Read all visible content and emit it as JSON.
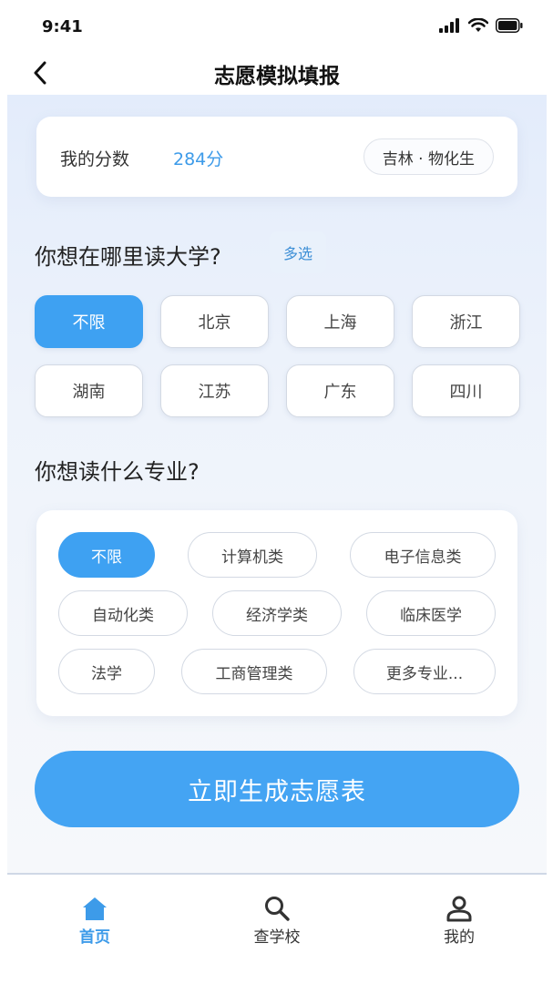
{
  "status_bar": {
    "time": "9:41"
  },
  "nav": {
    "title": "志愿模拟填报"
  },
  "score_card": {
    "label": "我的分数",
    "score": "284分",
    "region": "吉林 · 物化生"
  },
  "location_section": {
    "title": "你想在哪里读大学?",
    "multi_label": "多选",
    "cities": [
      {
        "label": "不限",
        "selected": true
      },
      {
        "label": "北京"
      },
      {
        "label": "上海"
      },
      {
        "label": "浙江"
      },
      {
        "label": "湖南"
      },
      {
        "label": "江苏"
      },
      {
        "label": "广东"
      },
      {
        "label": "四川"
      }
    ]
  },
  "major_section": {
    "title": "你想读什么专业?",
    "majors": [
      {
        "label": "不限",
        "selected": true
      },
      {
        "label": "计算机类"
      },
      {
        "label": "电子信息类"
      },
      {
        "label": "自动化类"
      },
      {
        "label": "经济学类"
      },
      {
        "label": "临床医学"
      },
      {
        "label": "法学"
      },
      {
        "label": "工商管理类"
      },
      {
        "label": "更多专业..."
      }
    ]
  },
  "cta": {
    "label": "立即生成志愿表"
  },
  "tab_bar": {
    "tabs": [
      {
        "label": "首页",
        "icon": "home-icon",
        "active": true
      },
      {
        "label": "查学校",
        "icon": "search-icon"
      },
      {
        "label": "我的",
        "icon": "user-icon"
      }
    ]
  },
  "colors": {
    "accent": "#3ea1f2",
    "score": "#3d9be9",
    "background_top": "#e3ecfb"
  }
}
